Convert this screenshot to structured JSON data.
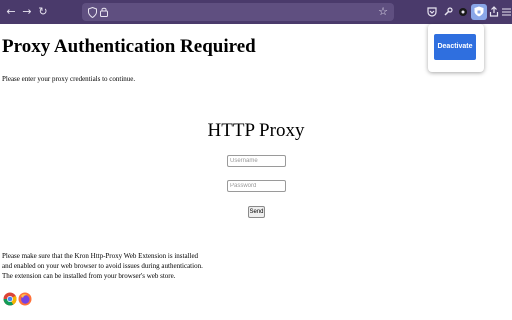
{
  "browser": {
    "nav": {
      "back_icon": "←",
      "forward_icon": "→",
      "reload_icon": "↻"
    },
    "urlbar": {
      "shield_icon": "shield-icon",
      "lock_icon": "lock-icon",
      "star_icon": "☆"
    },
    "toolbar_icons": [
      "pocket-icon",
      "wrench-icon",
      "gear-icon",
      "kron-proxy-extension-icon",
      "share-icon",
      "menu-icon"
    ]
  },
  "popup": {
    "deactivate_label": "Deactivate",
    "button_color": "#2f6fdf"
  },
  "page": {
    "title": "Proxy Authentication Required",
    "intro": "Please enter your proxy credentials to continue.",
    "form": {
      "heading": "HTTP Proxy",
      "username_placeholder": "Username",
      "password_placeholder": "Password",
      "send_label": "Send"
    },
    "note_lines": [
      "Please make sure that the Kron Http-Proxy Web Extension is installed",
      "and enabled on your web browser to avoid issues during authentication.",
      "The extension can be installed from your browser's web store."
    ],
    "store_icons": [
      "chrome-icon",
      "firefox-icon"
    ]
  },
  "colors": {
    "toolbar": "#4a3a6b",
    "urlbar": "#5f4f80"
  }
}
